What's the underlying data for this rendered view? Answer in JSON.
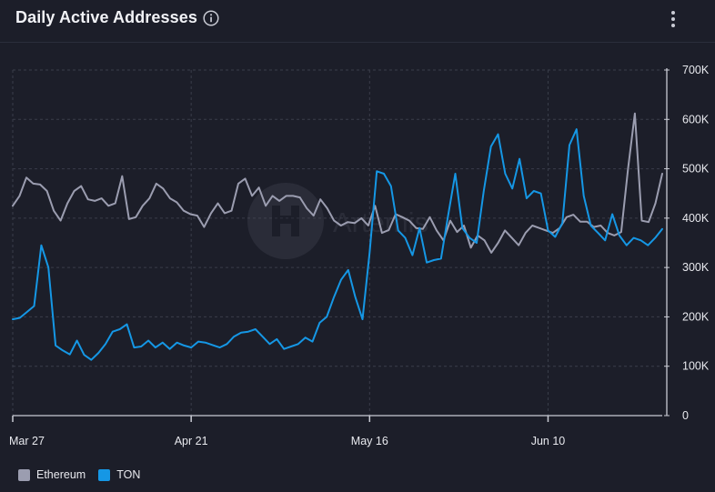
{
  "header": {
    "title": "Daily Active Addresses",
    "info_icon": "info-circle-icon",
    "menu_icon": "vertical-ellipsis-icon"
  },
  "watermark": {
    "text": "Artemis",
    "icon": "artemis-logo-icon"
  },
  "colors": {
    "background": "#1c1e29",
    "grid": "#3a3d4a",
    "axis": "#c9cbd4",
    "ethereum": "#9b9db0",
    "ton": "#1597e5"
  },
  "chart_data": {
    "type": "line",
    "title": "Daily Active Addresses",
    "x_start": "Mar 27",
    "x_ticks": [
      {
        "label": "Mar 27",
        "day": 0
      },
      {
        "label": "Apr 21",
        "day": 25
      },
      {
        "label": "May 16",
        "day": 50
      },
      {
        "label": "Jun 10",
        "day": 75
      }
    ],
    "y_axis_side": "right",
    "ylim": [
      0,
      700000
    ],
    "y_ticks": [
      {
        "value": 0,
        "label": "0"
      },
      {
        "value": 100000,
        "label": "100K"
      },
      {
        "value": 200000,
        "label": "200K"
      },
      {
        "value": 300000,
        "label": "300K"
      },
      {
        "value": 400000,
        "label": "400K"
      },
      {
        "value": 500000,
        "label": "500K"
      },
      {
        "value": 600000,
        "label": "600K"
      },
      {
        "value": 700000,
        "label": "700K"
      }
    ],
    "grid": true,
    "legend_position": "bottom-left",
    "series": [
      {
        "name": "Ethereum",
        "color": "#9b9db0",
        "values": [
          425000,
          445000,
          482000,
          470000,
          468000,
          455000,
          415000,
          395000,
          430000,
          455000,
          465000,
          438000,
          435000,
          440000,
          425000,
          430000,
          485000,
          398000,
          402000,
          425000,
          440000,
          470000,
          460000,
          440000,
          432000,
          415000,
          408000,
          405000,
          382000,
          410000,
          430000,
          410000,
          415000,
          470000,
          480000,
          445000,
          462000,
          425000,
          445000,
          435000,
          445000,
          445000,
          442000,
          420000,
          405000,
          438000,
          420000,
          395000,
          385000,
          392000,
          390000,
          400000,
          385000,
          425000,
          370000,
          376000,
          408000,
          402000,
          395000,
          380000,
          378000,
          402000,
          375000,
          355000,
          395000,
          372000,
          385000,
          340000,
          365000,
          355000,
          330000,
          350000,
          375000,
          360000,
          345000,
          370000,
          385000,
          380000,
          375000,
          370000,
          380000,
          402000,
          407000,
          393000,
          393000,
          382000,
          385000,
          370000,
          365000,
          372000,
          500000,
          612000,
          395000,
          392000,
          430000,
          490000
        ]
      },
      {
        "name": "TON",
        "color": "#1597e5",
        "values": [
          195000,
          198000,
          210000,
          222000,
          345000,
          300000,
          142000,
          132000,
          124000,
          152000,
          123000,
          113000,
          127000,
          145000,
          170000,
          175000,
          185000,
          138000,
          140000,
          152000,
          138000,
          148000,
          135000,
          148000,
          142000,
          138000,
          150000,
          148000,
          143000,
          138000,
          145000,
          160000,
          168000,
          170000,
          175000,
          160000,
          145000,
          155000,
          135000,
          140000,
          145000,
          158000,
          150000,
          188000,
          200000,
          240000,
          275000,
          295000,
          240000,
          195000,
          330000,
          495000,
          490000,
          465000,
          375000,
          360000,
          325000,
          380000,
          310000,
          315000,
          318000,
          405000,
          490000,
          380000,
          360000,
          350000,
          455000,
          545000,
          570000,
          490000,
          460000,
          520000,
          440000,
          455000,
          450000,
          375000,
          362000,
          390000,
          548000,
          580000,
          445000,
          385000,
          370000,
          355000,
          408000,
          365000,
          345000,
          360000,
          355000,
          345000,
          360000,
          378000
        ]
      }
    ]
  }
}
